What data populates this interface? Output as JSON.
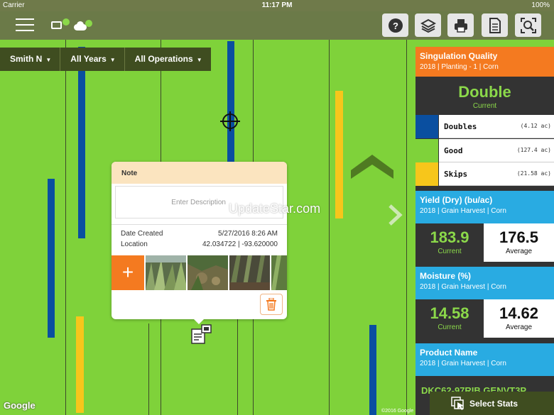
{
  "status_bar": {
    "carrier": "Carrier",
    "time": "11:17 PM",
    "battery": "100%"
  },
  "toolbar": {
    "menu_icon": "hamburger-icon",
    "icons": [
      "help-icon",
      "layers-icon",
      "print-icon",
      "document-icon",
      "search-icon"
    ]
  },
  "filters": {
    "client": "Smith N",
    "years": "All Years",
    "operations": "All Operations"
  },
  "note": {
    "title": "Note",
    "placeholder": "Enter Description",
    "date_label": "Date Created",
    "date_value": "5/27/2016 8:26 AM",
    "location_label": "Location",
    "location_value": "42.034722 | -93.620000",
    "add_label": "+"
  },
  "watermark": "UpdateStar.com",
  "google": "Google",
  "copyright": "©2016 Google",
  "panel": {
    "singulation": {
      "title": "Singulation Quality",
      "subtitle": "2018 | Planting - 1 | Corn",
      "current_value": "Double",
      "current_label": "Current",
      "legend": [
        {
          "name": "Doubles",
          "area": "(4.12 ac)",
          "color": "#0a4fa0"
        },
        {
          "name": "Good",
          "area": "(127.4 ac)",
          "color": "#7fd23a"
        },
        {
          "name": "Skips",
          "area": "(21.58 ac)",
          "color": "#f7c61b"
        }
      ]
    },
    "yield": {
      "title": "Yield (Dry) (bu/ac)",
      "subtitle": "2018 | Grain Harvest | Corn",
      "current": "183.9",
      "current_label": "Current",
      "average": "176.5",
      "average_label": "Average"
    },
    "moisture": {
      "title": "Moisture (%)",
      "subtitle": "2018 | Grain Harvest | Corn",
      "current": "14.58",
      "current_label": "Current",
      "average": "14.62",
      "average_label": "Average"
    },
    "product": {
      "title": "Product Name",
      "subtitle": "2018 | Grain Harvest | Corn",
      "value": "DKC62-97RIB GENVT3P"
    }
  },
  "select_stats": "Select Stats",
  "colors": {
    "orange": "#f47a20",
    "blue": "#29abe2",
    "olive": "#6b7a48",
    "field_green": "#7fd23a"
  }
}
